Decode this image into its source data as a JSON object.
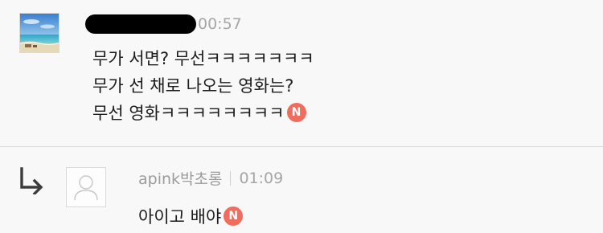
{
  "comments": [
    {
      "author_redacted": true,
      "time": "00:57",
      "lines": [
        "무가 서면? 무선ㅋㅋㅋㅋㅋㅋㅋ",
        "무가 선 채로 나오는 영화는?",
        "무선 영화ㅋㅋㅋㅋㅋㅋㅋㅋ"
      ],
      "badge": "N",
      "avatar": "beach-photo"
    }
  ],
  "reply": {
    "author": "apink박초롱",
    "time": "01:09",
    "text": "아이고 배야",
    "badge": "N",
    "avatar": "default-user-icon",
    "indicator_icon": "reply-arrow-icon"
  },
  "colors": {
    "background": "#f8f8f8",
    "badge": "#f26c5d",
    "meta_text": "#a8a8a8",
    "divider": "#d8d8d8"
  }
}
